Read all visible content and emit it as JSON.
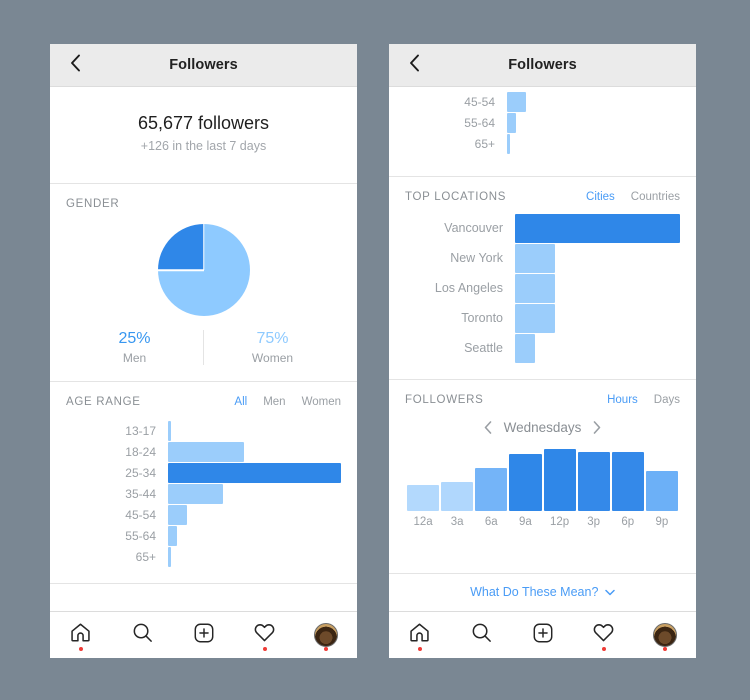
{
  "background_color": "#7a8793",
  "accent_blue": "#3897f0",
  "bar_light": "#9bcdfb",
  "bar_dark": "#2f87e8",
  "left_phone": {
    "nav": {
      "back_icon": "chevron-left-icon",
      "title": "Followers"
    },
    "summary": {
      "count": "65,677 followers",
      "subtitle": "+126 in the last 7 days"
    },
    "gender": {
      "title": "GENDER",
      "men_pct": "25%",
      "men_label": "Men",
      "women_pct": "75%",
      "women_label": "Women"
    },
    "age_range": {
      "title": "AGE RANGE",
      "tabs": [
        {
          "label": "All",
          "active": true
        },
        {
          "label": "Men",
          "active": false
        },
        {
          "label": "Women",
          "active": false
        }
      ]
    }
  },
  "right_phone": {
    "nav": {
      "back_icon": "chevron-left-icon",
      "title": "Followers"
    },
    "locations": {
      "title": "TOP LOCATIONS",
      "tabs": [
        {
          "label": "Cities",
          "active": true
        },
        {
          "label": "Countries",
          "active": false
        }
      ]
    },
    "followers_hours": {
      "title": "FOLLOWERS",
      "tabs": [
        {
          "label": "Hours",
          "active": true
        },
        {
          "label": "Days",
          "active": false
        }
      ],
      "day": "Wednesdays",
      "prev_icon": "chevron-left-icon",
      "next_icon": "chevron-right-icon",
      "footer_link": "What Do These Mean?",
      "footer_icon": "chevron-down-icon"
    }
  },
  "tabbar": {
    "items": [
      {
        "icon": "home-icon",
        "badge": true
      },
      {
        "icon": "search-icon",
        "badge": false
      },
      {
        "icon": "add-post-icon",
        "badge": false
      },
      {
        "icon": "heart-icon",
        "badge": true
      },
      {
        "icon": "profile-avatar-icon",
        "badge": true
      }
    ]
  },
  "chart_data": [
    {
      "type": "pie",
      "title": "GENDER",
      "labels": [
        "Men",
        "Women"
      ],
      "values": [
        25,
        75
      ],
      "colors": [
        "#2f87e8",
        "#8ecaff"
      ],
      "legend": "below"
    },
    {
      "type": "bar",
      "orientation": "horizontal",
      "title": "AGE RANGE",
      "categories": [
        "13-17",
        "18-24",
        "25-34",
        "35-44",
        "45-54",
        "55-64",
        "65+"
      ],
      "values": [
        2,
        44,
        100,
        32,
        11,
        5,
        2
      ],
      "highlight_index": 2,
      "xlabel": "",
      "ylabel": "",
      "grid": false
    },
    {
      "type": "bar",
      "orientation": "horizontal",
      "title": "TOP LOCATIONS",
      "categories": [
        "Vancouver",
        "New York",
        "Los Angeles",
        "Toronto",
        "Seattle"
      ],
      "values": [
        100,
        24,
        24,
        24,
        12
      ],
      "highlight_index": 0,
      "xlabel": "",
      "ylabel": "",
      "grid": false
    },
    {
      "type": "bar",
      "orientation": "vertical",
      "title": "FOLLOWERS",
      "subtitle": "Wednesdays",
      "categories": [
        "12a",
        "3a",
        "6a",
        "9a",
        "12p",
        "3p",
        "6p",
        "9p"
      ],
      "values": [
        37,
        41,
        62,
        82,
        88,
        84,
        84,
        57
      ],
      "colors": [
        "#b3d9fd",
        "#b0d7fd",
        "#74b4f8",
        "#2f87e8",
        "#2f87e8",
        "#3489e9",
        "#3489e9",
        "#6cb0f7"
      ],
      "xlabel": "",
      "ylabel": "",
      "grid": false
    }
  ]
}
